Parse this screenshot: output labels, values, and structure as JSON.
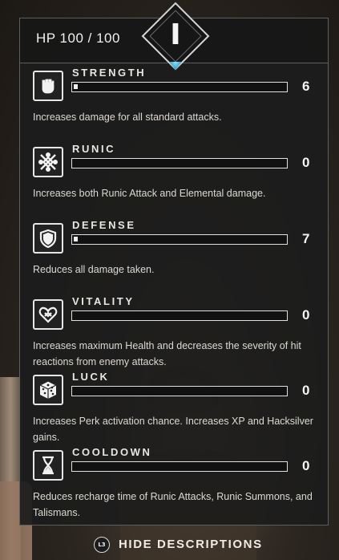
{
  "header": {
    "hp_text": "HP 100 / 100",
    "level": "I"
  },
  "stats": [
    {
      "name": "STRENGTH",
      "value": "6",
      "fill": 0.02,
      "icon": "fist-icon",
      "description": "Increases damage for all standard attacks."
    },
    {
      "name": "RUNIC",
      "value": "0",
      "fill": 0,
      "icon": "runic-knot-icon",
      "description": "Increases both Runic Attack and Elemental damage."
    },
    {
      "name": "DEFENSE",
      "value": "7",
      "fill": 0.02,
      "icon": "shield-icon",
      "description": "Reduces all damage taken."
    },
    {
      "name": "VITALITY",
      "value": "0",
      "fill": 0,
      "icon": "heart-knot-icon",
      "description": "Increases maximum Health and decreases the severity of hit reactions from enemy attacks."
    },
    {
      "name": "LUCK",
      "value": "0",
      "fill": 0,
      "icon": "dice-icon",
      "description": "Increases Perk activation chance. Increases XP and Hacksilver gains."
    },
    {
      "name": "COOLDOWN",
      "value": "0",
      "fill": 0,
      "icon": "hourglass-icon",
      "description": "Reduces recharge time of Runic Attacks, Runic Summons, and Talismans."
    }
  ],
  "footer": {
    "button_glyph": "L3",
    "label": "HIDE DESCRIPTIONS"
  },
  "colors": {
    "panel_bg": "#1c1c1c",
    "border": "#5e5e5e",
    "accent_tip": "#1b8fb8",
    "text": "#e8e6e1"
  }
}
